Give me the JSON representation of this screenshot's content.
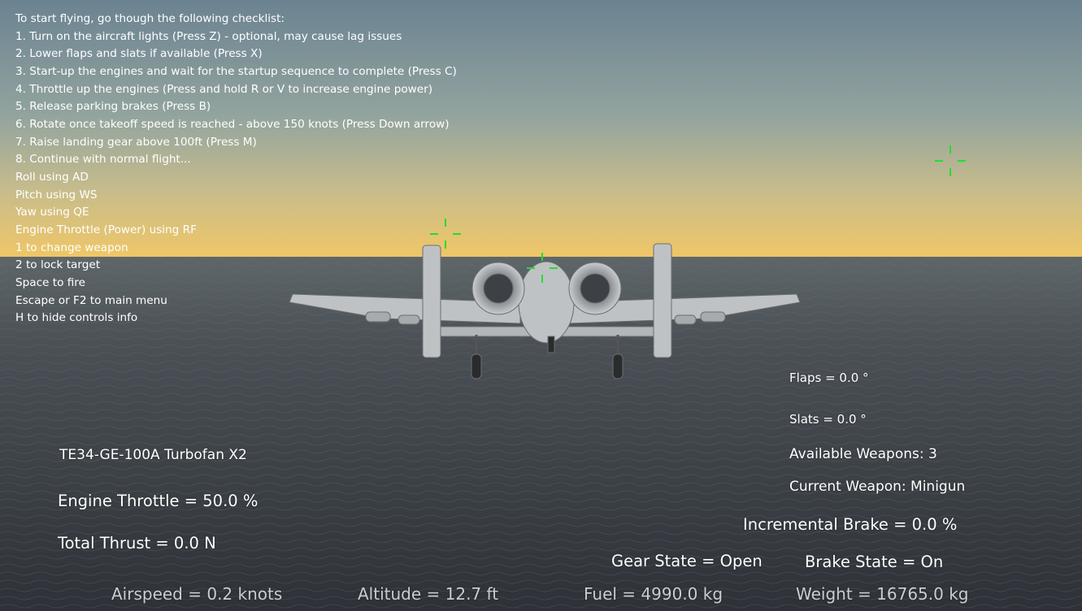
{
  "controls_info": [
    "To start flying, go though the following checklist:",
    "1. Turn on the aircraft lights (Press Z) - optional, may cause lag issues",
    "2. Lower flaps and slats if available (Press X)",
    "3. Start-up the engines and wait for the startup sequence to complete (Press C)",
    "4. Throttle up the engines (Press and hold R or V to increase engine power)",
    "5. Release parking brakes (Press B)",
    "6. Rotate once takeoff speed is reached - above 150 knots (Press Down arrow)",
    "7. Raise landing gear above 100ft (Press M)",
    "8. Continue with normal flight...",
    "Roll using AD",
    "Pitch using WS",
    "Yaw using QE",
    "Engine Throttle (Power) using RF",
    "1 to change weapon",
    "2 to lock target",
    "Space to fire",
    "Escape or F2 to main menu",
    "H to hide controls info"
  ],
  "engine": {
    "name": "TE34-GE-100A Turbofan X2",
    "throttle": "Engine Throttle = 50.0 %",
    "thrust": "Total Thrust = 0.0 N"
  },
  "aero": {
    "flaps": "Flaps = 0.0 °",
    "slats": "Slats = 0.0 °"
  },
  "weapons": {
    "available": "Available Weapons: 3",
    "current": "Current Weapon: Minigun"
  },
  "brakes": {
    "incremental": "Incremental Brake = 0.0 %",
    "state": "Brake State = On"
  },
  "gear": {
    "state": "Gear State = Open"
  },
  "status_bar": {
    "airspeed": "Airspeed = 0.2 knots",
    "altitude": "Altitude = 12.7 ft",
    "fuel": "Fuel = 4990.0 kg",
    "weight": "Weight = 16765.0 kg"
  },
  "colors": {
    "sky_top": "#6d8491",
    "sky_horizon": "#e8c46a",
    "sea": "#3a3f46",
    "reticle": "#22dd33"
  }
}
